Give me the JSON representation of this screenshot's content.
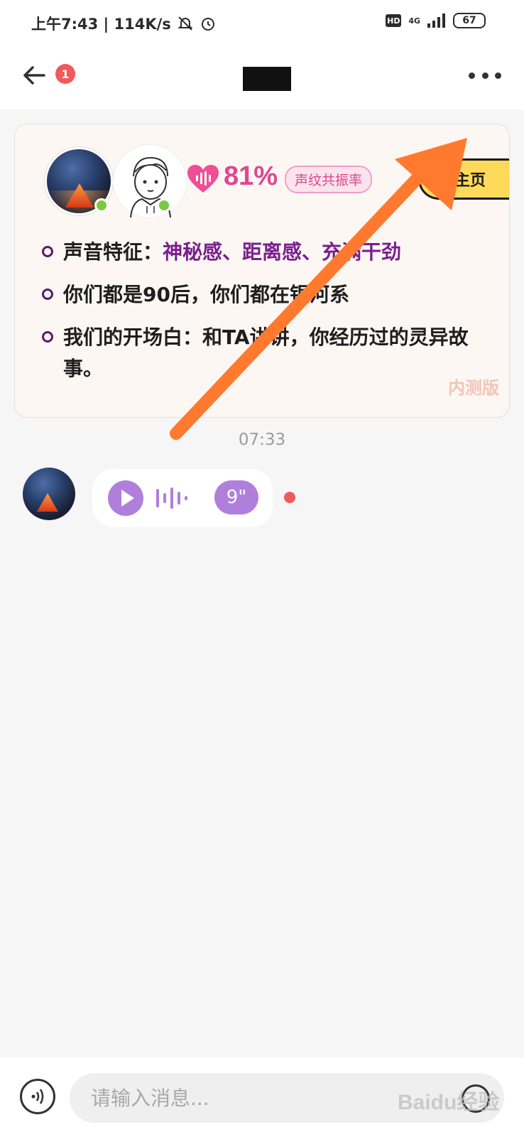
{
  "status_bar": {
    "time_speed": "上午7:43 | 114K/s",
    "hd": "HD",
    "network": "4G",
    "battery": "67"
  },
  "nav": {
    "unread_count": "1",
    "title": "████"
  },
  "match_card": {
    "percent": "81%",
    "percent_label": "声纹共振率",
    "view_profile": "看主页",
    "traits": [
      {
        "prefix": "声音特征：",
        "highlight": "神秘感、距离感、充满干劲"
      },
      {
        "prefix": "你们都是90后，你们都在银河系",
        "highlight": ""
      },
      {
        "prefix": "我们的开场白：和TA讲讲，你经历过的灵异故事。",
        "highlight": ""
      }
    ],
    "beta_stamp": "内测版"
  },
  "chat": {
    "timestamp": "07:33",
    "voice_message": {
      "duration": "9\""
    }
  },
  "input_bar": {
    "placeholder": "请输入消息..."
  },
  "watermark": "Baidu经验",
  "colors": {
    "accent_purple": "#b07fdc",
    "match_pink": "#e0468f",
    "badge_red": "#f25a5a",
    "annotation_arrow": "#ff7a2e"
  }
}
